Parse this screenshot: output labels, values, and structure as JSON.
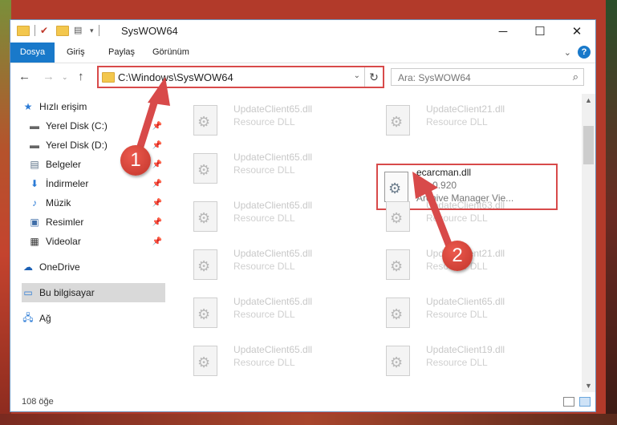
{
  "window": {
    "title": "SysWOW64",
    "controls": {
      "minimize": "─",
      "maximize": "☐",
      "close": "✕"
    }
  },
  "ribbon": {
    "tabs": [
      "Dosya",
      "Giriş",
      "Paylaş",
      "Görünüm"
    ],
    "help": "?"
  },
  "nav": {
    "back": "←",
    "forward": "→",
    "up": "↑",
    "address": "C:\\Windows\\SysWOW64",
    "search_placeholder": "Ara: SysWOW64"
  },
  "sidebar": {
    "items": [
      {
        "label": "Hızlı erişim",
        "icon": "star-icon",
        "pinned": false
      },
      {
        "label": "Yerel Disk (C:)",
        "icon": "drive-icon",
        "pinned": true
      },
      {
        "label": "Yerel Disk (D:)",
        "icon": "drive-icon",
        "pinned": true
      },
      {
        "label": "Belgeler",
        "icon": "documents-icon",
        "pinned": true
      },
      {
        "label": "İndirmeler",
        "icon": "download-icon",
        "pinned": true
      },
      {
        "label": "Müzik",
        "icon": "music-icon",
        "pinned": true
      },
      {
        "label": "Resimler",
        "icon": "pictures-icon",
        "pinned": true
      },
      {
        "label": "Videolar",
        "icon": "videos-icon",
        "pinned": true
      },
      {
        "label": "OneDrive",
        "icon": "cloud-icon",
        "pinned": false
      },
      {
        "label": "Bu bilgisayar",
        "icon": "computer-icon",
        "pinned": false
      },
      {
        "label": "Ağ",
        "icon": "network-icon",
        "pinned": false
      }
    ]
  },
  "files": [
    {
      "name": "UpdateClient65.dll",
      "desc": "Resource DLL"
    },
    {
      "name": "UpdateClient21.dll",
      "desc": "Resource DLL"
    },
    {
      "name": "UpdateClient65.dll",
      "desc": "Resource DLL"
    },
    {
      "name": "ecarcman.dll",
      "version": "7.0.0.920",
      "desc": "Archive Manager Vie...",
      "highlighted": true
    },
    {
      "name": "UpdateClient65.dll",
      "desc": "Resource DLL"
    },
    {
      "name": "UpdateClient63.dll",
      "desc": "Resource DLL"
    },
    {
      "name": "UpdateClient65.dll",
      "desc": "Resource DLL"
    },
    {
      "name": "UpdateClient21.dll",
      "desc": "Resource DLL"
    },
    {
      "name": "UpdateClient65.dll",
      "desc": "Resource DLL"
    },
    {
      "name": "UpdateClient65.dll",
      "desc": "Resource DLL"
    },
    {
      "name": "UpdateClient65.dll",
      "desc": "Resource DLL"
    },
    {
      "name": "UpdateClient19.dll",
      "desc": "Resource DLL"
    }
  ],
  "status": {
    "count": "108 öğe"
  },
  "annotations": {
    "badge1": "1",
    "badge2": "2",
    "color": "#d84a4a"
  }
}
